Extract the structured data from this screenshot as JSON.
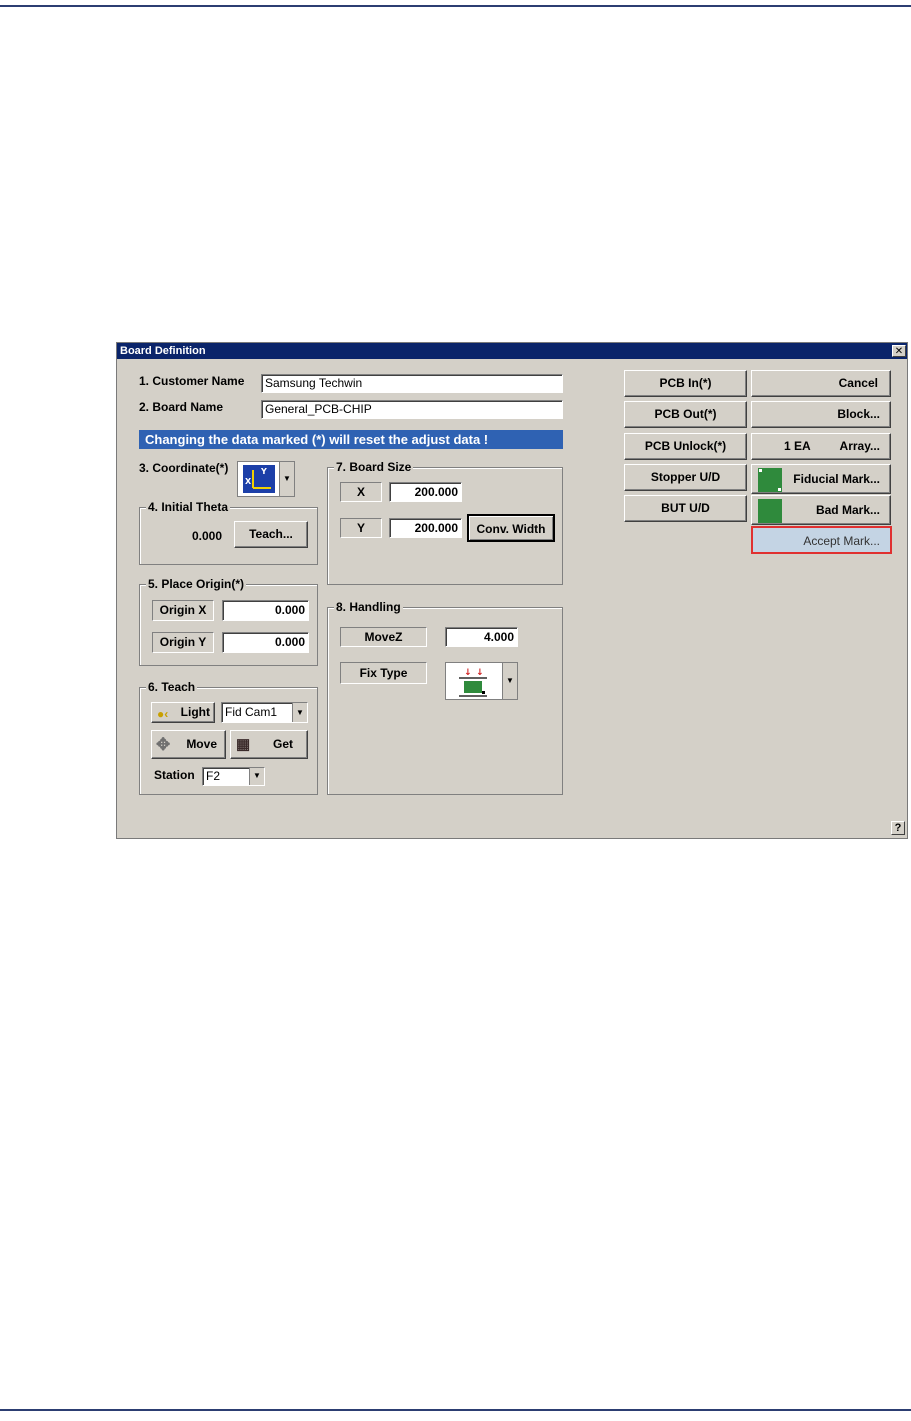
{
  "window": {
    "title": "Board Definition",
    "close_glyph": "✕",
    "help_glyph": "?"
  },
  "fields": {
    "customer_name_label": "1. Customer Name",
    "customer_name_value": "Samsung Techwin",
    "board_name_label": "2. Board Name",
    "board_name_value": "General_PCB-CHIP"
  },
  "warning": "Changing the data marked (*) will reset the adjust data !",
  "coordinate": {
    "label": "3. Coordinate(*)",
    "icon": "coordinate-axes-icon"
  },
  "initial_theta": {
    "title": "4. Initial Theta",
    "value": "0.000",
    "teach_label": "Teach..."
  },
  "place_origin": {
    "title": "5. Place Origin(*)",
    "origin_x_label": "Origin X",
    "origin_x_value": "0.000",
    "origin_y_label": "Origin Y",
    "origin_y_value": "0.000"
  },
  "teach": {
    "title": "6. Teach",
    "light_label": "Light",
    "camera_value": "Fid Cam1",
    "move_label": "Move",
    "get_label": "Get",
    "station_label": "Station",
    "station_value": "F2"
  },
  "board_size": {
    "title": "7. Board Size",
    "x_label": "X",
    "x_value": "200.000",
    "y_label": "Y",
    "y_value": "200.000",
    "conv_width_label": "Conv. Width"
  },
  "handling": {
    "title": "8. Handling",
    "movez_label": "MoveZ",
    "movez_value": "4.000",
    "fix_type_label": "Fix Type"
  },
  "right_buttons": {
    "pcb_in": "PCB In(*)",
    "pcb_out": "PCB Out(*)",
    "pcb_unlock": "PCB Unlock(*)",
    "stopper": "Stopper U/D",
    "but": "BUT U/D",
    "cancel": "Cancel",
    "block": "Block...",
    "array_count": "1 EA",
    "array": "Array...",
    "fiducial": "Fiducial Mark...",
    "bad_mark": "Bad Mark...",
    "accept_mark": "Accept Mark..."
  },
  "colors": {
    "title_bar": "#0a246a",
    "warning_bar": "#2f62b3",
    "highlight_border": "#e03030",
    "mark_green": "#2f8a3c"
  }
}
